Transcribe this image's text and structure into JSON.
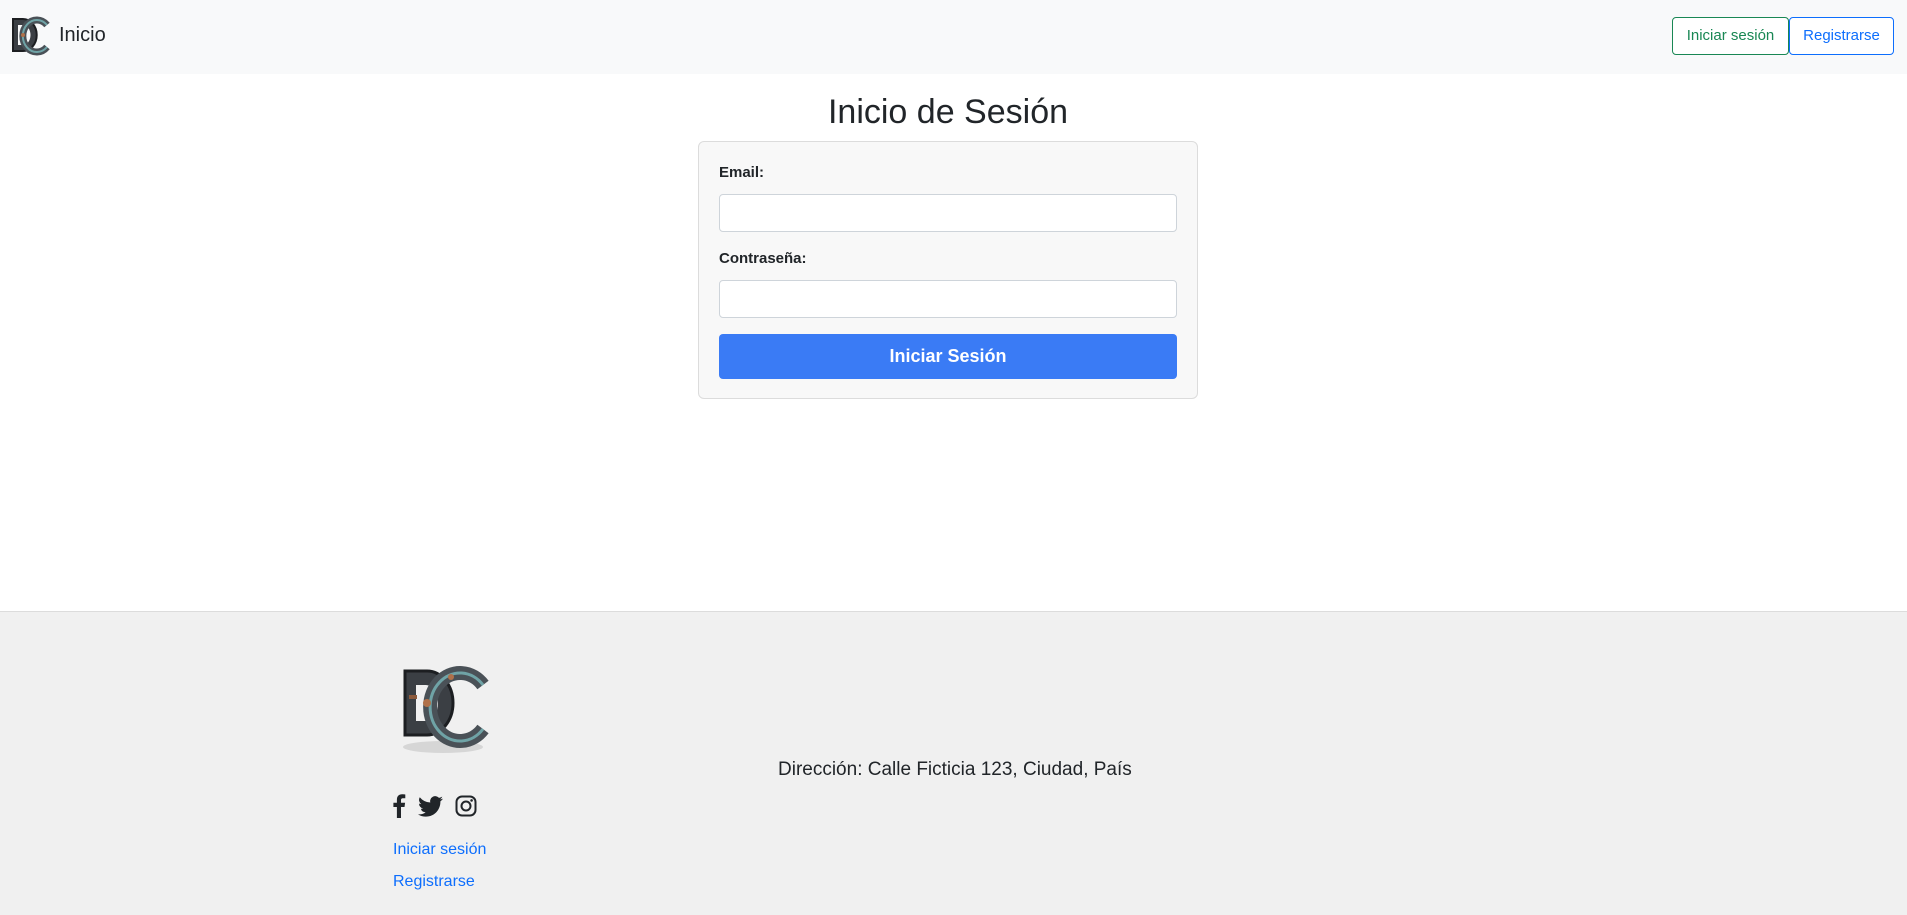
{
  "navbar": {
    "brand_label": "Inicio",
    "login_label": "Iniciar sesión",
    "register_label": "Registrarse",
    "logo_icon": "dc-monogram-logo"
  },
  "main": {
    "title": "Inicio de Sesión",
    "email_label": "Email:",
    "email_value": "",
    "password_label": "Contraseña:",
    "password_value": "",
    "submit_label": "Iniciar Sesión"
  },
  "footer": {
    "logo_icon": "dc-monogram-logo",
    "social_icons": [
      "facebook-icon",
      "twitter-icon",
      "instagram-icon"
    ],
    "links": [
      "Iniciar sesión",
      "Registrarse"
    ],
    "address": "Dirección: Calle Ficticia 123, Ciudad, País"
  },
  "colors": {
    "navbar_bg": "#f8f9fa",
    "footer_bg": "#f0f0f0",
    "primary": "#0d6efd",
    "success": "#198754",
    "submit_bg": "#3a7bf5"
  }
}
